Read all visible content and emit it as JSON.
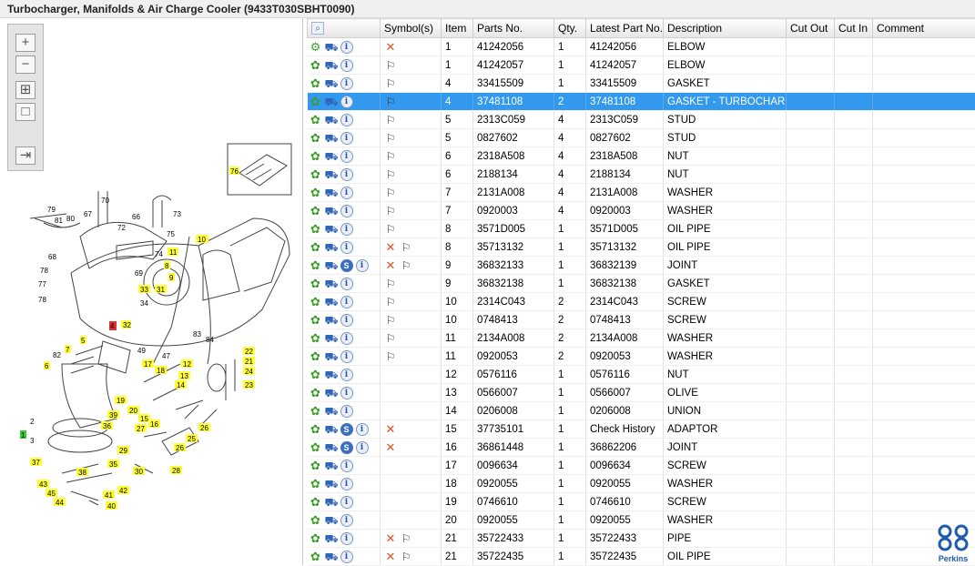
{
  "window": {
    "title": "Turbocharger, Manifolds & Air Charge Cooler (9433T030SBHT0090)"
  },
  "toolbar": {
    "zoom_in": "+",
    "zoom_out": "−",
    "fit": "⊞",
    "actual": "□",
    "export": "⇥"
  },
  "diagram": {
    "callouts": [
      "79",
      "81",
      "80",
      "67",
      "70",
      "72",
      "66",
      "73",
      "75",
      "10",
      "68",
      "74",
      "11",
      "8",
      "9",
      "76",
      "78",
      "77",
      "69",
      "33",
      "31",
      "4",
      "32",
      "34",
      "78",
      "5",
      "7",
      "82",
      "6",
      "83",
      "84",
      "22",
      "21",
      "24",
      "23",
      "49",
      "47",
      "17",
      "18",
      "12",
      "13",
      "14",
      "19",
      "20",
      "15",
      "16",
      "27",
      "25",
      "26",
      "39",
      "36",
      "2",
      "1",
      "3",
      "29",
      "30",
      "28",
      "37",
      "38",
      "35",
      "43",
      "45",
      "44",
      "42",
      "41",
      "40"
    ]
  },
  "table": {
    "columns": [
      "",
      "Symbol(s)",
      "Item",
      "Parts No.",
      "Qty.",
      "Latest Part No.",
      "Description",
      "Cut Out",
      "Cut In",
      "Comment"
    ],
    "rows": [
      {
        "actions": "gear2",
        "sym": "x",
        "item": "1",
        "part": "41242056",
        "qty": "1",
        "latest": "41242056",
        "desc": "ELBOW"
      },
      {
        "actions": "gear",
        "sym": "note",
        "item": "1",
        "part": "41242057",
        "qty": "1",
        "latest": "41242057",
        "desc": "ELBOW"
      },
      {
        "actions": "gear",
        "sym": "note",
        "item": "4",
        "part": "33415509",
        "qty": "1",
        "latest": "33415509",
        "desc": "GASKET"
      },
      {
        "actions": "gear",
        "sym": "note",
        "item": "4",
        "part": "37481108",
        "qty": "2",
        "latest": "37481108",
        "desc": "GASKET - TURBOCHARGER",
        "selected": true
      },
      {
        "actions": "gear",
        "sym": "note",
        "item": "5",
        "part": "2313C059",
        "qty": "4",
        "latest": "2313C059",
        "desc": "STUD"
      },
      {
        "actions": "gear",
        "sym": "note",
        "item": "5",
        "part": "0827602",
        "qty": "4",
        "latest": "0827602",
        "desc": "STUD"
      },
      {
        "actions": "gear",
        "sym": "note",
        "item": "6",
        "part": "2318A508",
        "qty": "4",
        "latest": "2318A508",
        "desc": "NUT"
      },
      {
        "actions": "gear",
        "sym": "note",
        "item": "6",
        "part": "2188134",
        "qty": "4",
        "latest": "2188134",
        "desc": "NUT"
      },
      {
        "actions": "gear",
        "sym": "note",
        "item": "7",
        "part": "2131A008",
        "qty": "4",
        "latest": "2131A008",
        "desc": "WASHER"
      },
      {
        "actions": "gear",
        "sym": "note",
        "item": "7",
        "part": "0920003",
        "qty": "4",
        "latest": "0920003",
        "desc": "WASHER"
      },
      {
        "actions": "gear",
        "sym": "note",
        "item": "8",
        "part": "3571D005",
        "qty": "1",
        "latest": "3571D005",
        "desc": "OIL PIPE"
      },
      {
        "actions": "gear",
        "sym": "xnote",
        "item": "8",
        "part": "35713132",
        "qty": "1",
        "latest": "35713132",
        "desc": "OIL PIPE"
      },
      {
        "actions": "gearS",
        "sym": "xnote",
        "item": "9",
        "part": "36832133",
        "qty": "1",
        "latest": "36832139",
        "desc": "JOINT"
      },
      {
        "actions": "gear",
        "sym": "note",
        "item": "9",
        "part": "36832138",
        "qty": "1",
        "latest": "36832138",
        "desc": "GASKET"
      },
      {
        "actions": "gear",
        "sym": "note",
        "item": "10",
        "part": "2314C043",
        "qty": "2",
        "latest": "2314C043",
        "desc": "SCREW"
      },
      {
        "actions": "gear",
        "sym": "note",
        "item": "10",
        "part": "0748413",
        "qty": "2",
        "latest": "0748413",
        "desc": "SCREW"
      },
      {
        "actions": "gear",
        "sym": "note",
        "item": "11",
        "part": "2134A008",
        "qty": "2",
        "latest": "2134A008",
        "desc": "WASHER"
      },
      {
        "actions": "gear",
        "sym": "note",
        "item": "11",
        "part": "0920053",
        "qty": "2",
        "latest": "0920053",
        "desc": "WASHER"
      },
      {
        "actions": "gear",
        "sym": "",
        "item": "12",
        "part": "0576116",
        "qty": "1",
        "latest": "0576116",
        "desc": "NUT"
      },
      {
        "actions": "gear",
        "sym": "",
        "item": "13",
        "part": "0566007",
        "qty": "1",
        "latest": "0566007",
        "desc": "OLIVE"
      },
      {
        "actions": "gear",
        "sym": "",
        "item": "14",
        "part": "0206008",
        "qty": "1",
        "latest": "0206008",
        "desc": "UNION"
      },
      {
        "actions": "gearS",
        "sym": "x",
        "item": "15",
        "part": "37735101",
        "qty": "1",
        "latest": "Check History",
        "desc": "ADAPTOR"
      },
      {
        "actions": "gearS",
        "sym": "x",
        "item": "16",
        "part": "36861448",
        "qty": "1",
        "latest": "36862206",
        "desc": "JOINT"
      },
      {
        "actions": "gear",
        "sym": "",
        "item": "17",
        "part": "0096634",
        "qty": "1",
        "latest": "0096634",
        "desc": "SCREW"
      },
      {
        "actions": "gear",
        "sym": "",
        "item": "18",
        "part": "0920055",
        "qty": "1",
        "latest": "0920055",
        "desc": "WASHER"
      },
      {
        "actions": "gear",
        "sym": "",
        "item": "19",
        "part": "0746610",
        "qty": "1",
        "latest": "0746610",
        "desc": "SCREW"
      },
      {
        "actions": "gear",
        "sym": "",
        "item": "20",
        "part": "0920055",
        "qty": "1",
        "latest": "0920055",
        "desc": "WASHER"
      },
      {
        "actions": "gear",
        "sym": "xnote",
        "item": "21",
        "part": "35722433",
        "qty": "1",
        "latest": "35722433",
        "desc": "PIPE"
      },
      {
        "actions": "gear",
        "sym": "xnote",
        "item": "21",
        "part": "35722435",
        "qty": "1",
        "latest": "35722435",
        "desc": "OIL PIPE"
      }
    ]
  },
  "brand": {
    "name": "Perkins"
  },
  "colors": {
    "selection": "#3399ee",
    "accent": "#2f64b8",
    "callout": "#ffff33"
  }
}
